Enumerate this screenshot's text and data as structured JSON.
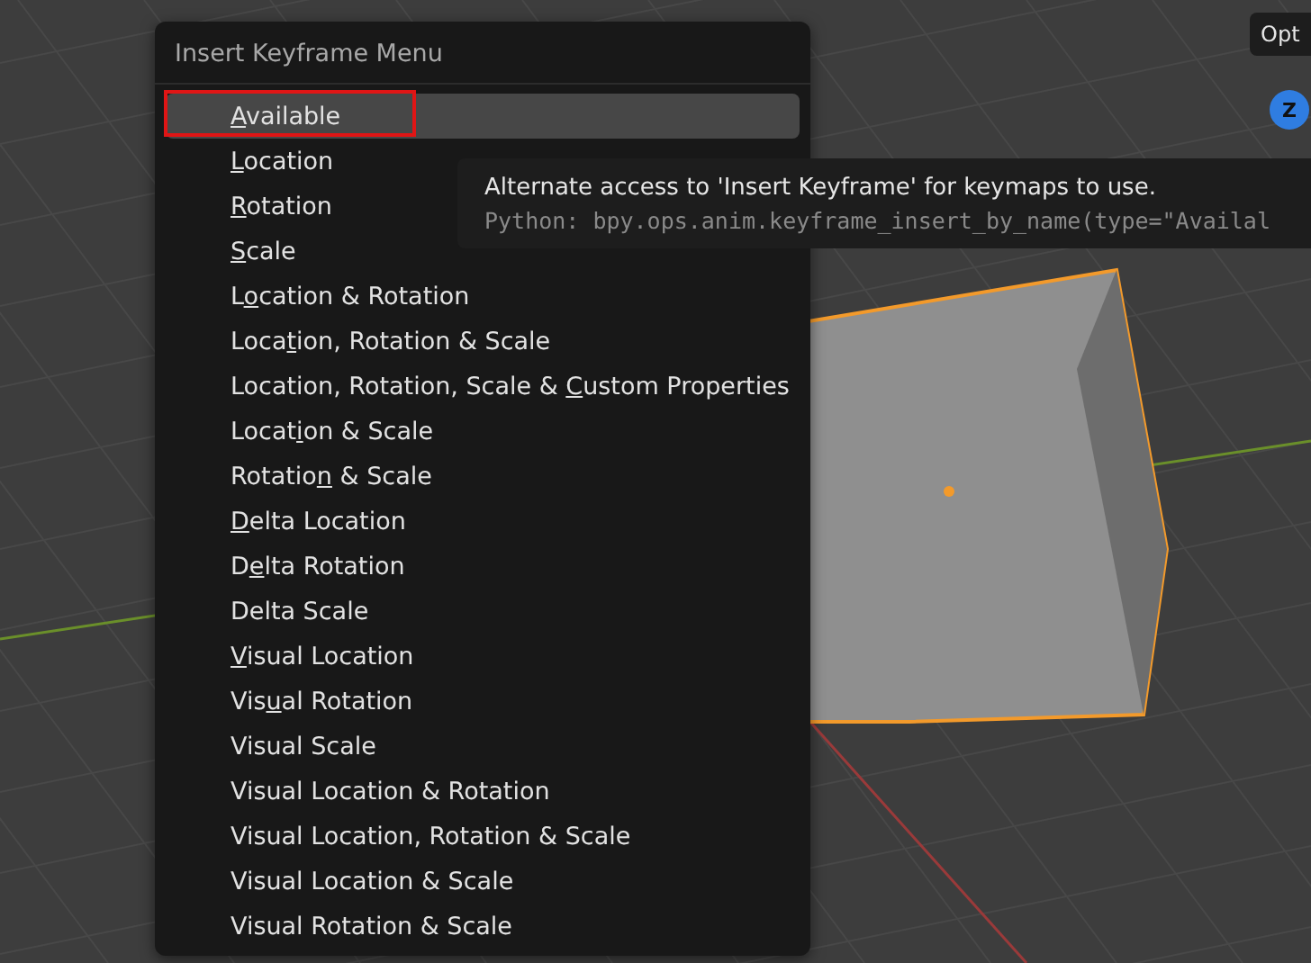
{
  "viewport": {
    "options_button": "Opt",
    "gizmo_axis": "Z"
  },
  "menu": {
    "title": "Insert Keyframe Menu",
    "items": [
      {
        "key": "A",
        "post": "vailable",
        "selected": true,
        "outlined": true
      },
      {
        "key": "L",
        "post": "ocation",
        "selected": false,
        "outlined": false
      },
      {
        "key": "R",
        "post": "otation",
        "selected": false,
        "outlined": false
      },
      {
        "key": "S",
        "post": "cale",
        "selected": false,
        "outlined": false
      },
      {
        "pre": "L",
        "key": "o",
        "post": "cation & Rotation",
        "selected": false,
        "outlined": false
      },
      {
        "pre": "Loca",
        "key": "t",
        "post": "ion, Rotation & Scale",
        "selected": false,
        "outlined": false
      },
      {
        "pre": "Location, Rotation, Scale & ",
        "key": "C",
        "post": "ustom Properties",
        "selected": false,
        "outlined": false
      },
      {
        "pre": "Locat",
        "key": "i",
        "post": "on & Scale",
        "selected": false,
        "outlined": false
      },
      {
        "pre": "Rotatio",
        "key": "n",
        "post": " & Scale",
        "selected": false,
        "outlined": false
      },
      {
        "key": "D",
        "post": "elta Location",
        "selected": false,
        "outlined": false
      },
      {
        "pre": "D",
        "key": "e",
        "post": "lta Rotation",
        "selected": false,
        "outlined": false
      },
      {
        "pre": "Delta Scale",
        "selected": false,
        "outlined": false
      },
      {
        "key": "V",
        "post": "isual Location",
        "selected": false,
        "outlined": false
      },
      {
        "pre": "Vis",
        "key": "u",
        "post": "al Rotation",
        "selected": false,
        "outlined": false
      },
      {
        "pre": "Visual Scale",
        "selected": false,
        "outlined": false
      },
      {
        "pre": "Visual Location & Rotation",
        "selected": false,
        "outlined": false
      },
      {
        "pre": "Visual Location, Rotation & Scale",
        "selected": false,
        "outlined": false
      },
      {
        "pre": "Visual Location & Scale",
        "selected": false,
        "outlined": false
      },
      {
        "pre": "Visual Rotation & Scale",
        "selected": false,
        "outlined": false
      }
    ]
  },
  "tooltip": {
    "description": "Alternate access to 'Insert Keyframe' for keymaps to use.",
    "python": "Python: bpy.ops.anim.keyframe_insert_by_name(type=\"Availal"
  }
}
